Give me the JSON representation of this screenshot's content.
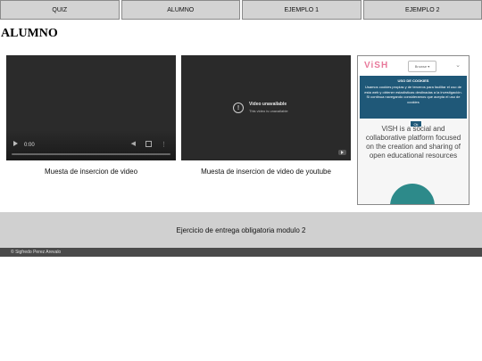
{
  "nav": {
    "items": [
      "QUIZ",
      "ALUMNO",
      "EJEMPLO 1",
      "EJEMPLO 2"
    ]
  },
  "page_title": "ALUMNO",
  "video1": {
    "time": "0:00",
    "caption": "Muesta de insercion de video"
  },
  "video2": {
    "title": "Video unavailable",
    "subtitle": "This video is unavailable",
    "caption": "Muesta de insercion de video de youtube"
  },
  "embed": {
    "logo": "ViSH",
    "select": "Browse ▾",
    "cookie_title": "USO DE COOKIES",
    "cookie_text": "Usamos cookies propias y de terceros para facilitar el uso de esta web y obtener estadísticas destinadas a la investigación. Si continua navegando consideramos que acepta el uso de cookies",
    "cookie_ok": "Ok",
    "description": "ViSH is a social and collaborative platform focused on the creation and sharing of open educational resources"
  },
  "footer": {
    "band_text": "Ejercicio de entrega obligatoria modulo 2",
    "copyright": "© Sigfredo Perez Arevalo"
  }
}
